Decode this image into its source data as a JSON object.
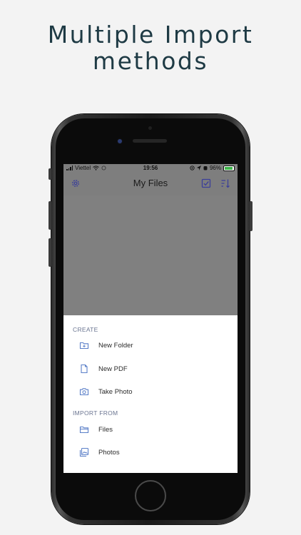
{
  "headline": {
    "line1": "Multiple Import",
    "line2": "methods"
  },
  "status_bar": {
    "carrier": "Viettel",
    "time": "19:56",
    "battery": "96%"
  },
  "nav": {
    "title": "My Files",
    "left_icon": "gear-icon",
    "right_icons": [
      "checkbox-icon",
      "sort-icon"
    ]
  },
  "sheet": {
    "create_header": "CREATE",
    "create_items": [
      {
        "label": "New Folder",
        "icon": "folder-plus-icon"
      },
      {
        "label": "New PDF",
        "icon": "document-icon"
      },
      {
        "label": "Take Photo",
        "icon": "camera-icon"
      }
    ],
    "import_header": "IMPORT FROM",
    "import_items": [
      {
        "label": "Files",
        "icon": "files-icon"
      },
      {
        "label": "Photos",
        "icon": "photos-icon"
      }
    ]
  },
  "colors": {
    "accent": "#4a4fb0",
    "icon_blue": "#5a7fc8",
    "headline": "#1e3a44",
    "overlay": "#808080"
  }
}
